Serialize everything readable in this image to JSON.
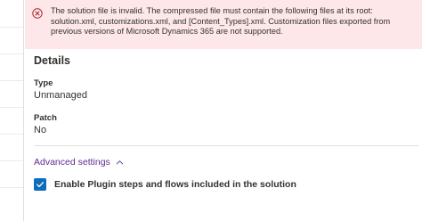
{
  "error_banner": {
    "message": "The solution file is invalid. The compressed file must contain the following files at its root: solution.xml, customizations.xml, and [Content_Types].xml. Customization files exported from previous versions of Microsoft Dynamics 365 are not supported.",
    "icon": "error-circle-icon",
    "background": "#fde7e9",
    "icon_color": "#a4262c"
  },
  "details": {
    "title": "Details",
    "type_label": "Type",
    "type_value": "Unmanaged",
    "patch_label": "Patch",
    "patch_value": "No"
  },
  "advanced": {
    "link_label": "Advanced settings",
    "chevron_icon": "chevron-up-icon",
    "link_color": "#5c2d91"
  },
  "plugin_option": {
    "label": "Enable Plugin steps and flows included in the solution",
    "checked": true,
    "checkbox_color": "#0f6cbd"
  }
}
